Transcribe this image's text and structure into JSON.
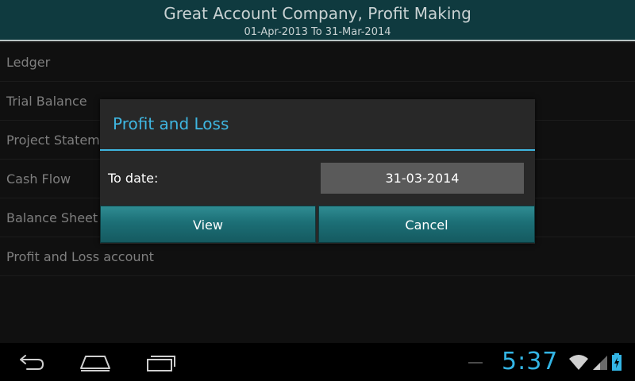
{
  "header": {
    "title": "Great Account Company, Profit Making",
    "subtitle": "01-Apr-2013 To 31-Mar-2014"
  },
  "menu": {
    "items": [
      {
        "label": "Ledger"
      },
      {
        "label": "Trial Balance"
      },
      {
        "label": "Project Statement"
      },
      {
        "label": "Cash Flow"
      },
      {
        "label": "Balance Sheet"
      },
      {
        "label": "Profit and Loss account"
      }
    ]
  },
  "dialog": {
    "title": "Profit and Loss",
    "to_date_label": "To date:",
    "to_date_value": "31-03-2014",
    "view_label": "View",
    "cancel_label": "Cancel"
  },
  "status_bar": {
    "time": "5:37"
  },
  "nav": {
    "back_icon": "back-icon",
    "home_icon": "home-icon",
    "recent_icon": "recent-apps-icon"
  },
  "colors": {
    "accent": "#33b5e5",
    "header_bg": "#0f3a3f",
    "button_bg": "#1c6f76"
  }
}
